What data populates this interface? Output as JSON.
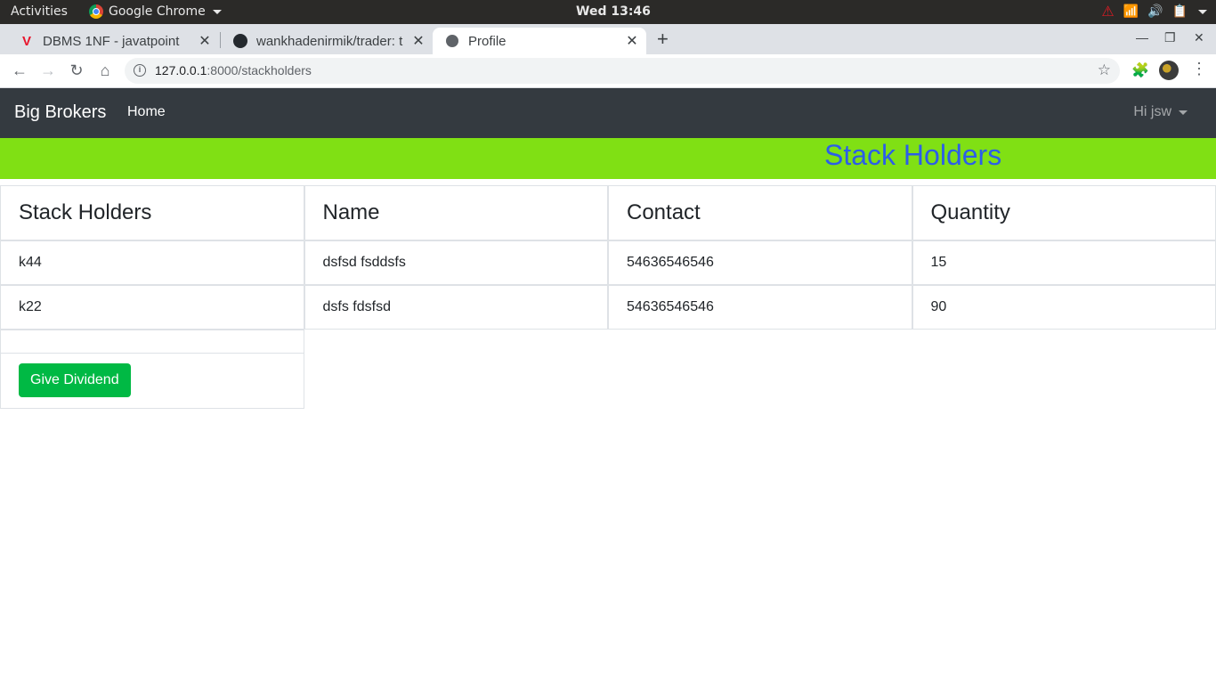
{
  "system_bar": {
    "activities": "Activities",
    "app_name": "Google Chrome",
    "clock": "Wed 13:46"
  },
  "browser": {
    "tabs": [
      {
        "title": "DBMS 1NF - javatpoint",
        "icon": "javatpoint-icon",
        "active": false
      },
      {
        "title": "wankhadenirmik/trader: t",
        "icon": "github-icon",
        "active": false
      },
      {
        "title": "Profile",
        "icon": "globe-icon",
        "active": true
      }
    ],
    "url_host": "127.0.0.1",
    "url_rest": ":8000/stackholders"
  },
  "navbar": {
    "brand": "Big Brokers",
    "home": "Home",
    "user": "Hi jsw"
  },
  "banner": {
    "title": "Stack Holders",
    "background_color": "#80e014",
    "title_color": "#2c5ee8"
  },
  "table": {
    "headers": [
      "Stack Holders",
      "Name",
      "Contact",
      "Quantity"
    ],
    "rows": [
      [
        "k44",
        "dsfsd fsddsfs",
        "54636546546",
        "15"
      ],
      [
        "k22",
        "dsfs fdsfsd",
        "54636546546",
        "90"
      ]
    ]
  },
  "actions": {
    "give_dividend": "Give Dividend",
    "button_color": "#00b944"
  }
}
